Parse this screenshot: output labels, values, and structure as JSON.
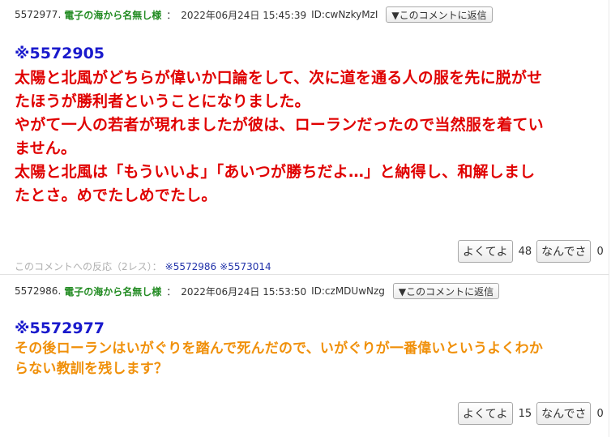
{
  "comments": [
    {
      "number": "5572977.",
      "name": "電子の海から名無し様",
      "separator": "：",
      "date": "2022年06月24日 15:45:39",
      "id": "ID:cwNzkyMzI",
      "reply_label": "▼このコメントに返信",
      "anchor": "※5572905",
      "body_lines": [
        "太陽と北風がどちらが偉いか口論をして、次に道を通る人の服を先に脱がせ",
        "たほうが勝利者ということになりました。",
        "やがて一人の若者が現れましたが彼は、ローランだったので当然服を着てい",
        "ません。",
        "太陽と北風は「もういいよ」「あいつが勝ちだよ…」と納得し、和解しまし",
        "たとさ。めでたしめでたし。"
      ],
      "good_label": "よくてよ",
      "good_count": "48",
      "bad_label": "なんでさ",
      "bad_count": "0",
      "reactions_label": "このコメントへの反応（2レス）：",
      "reactions": [
        "※5572986",
        "※5573014"
      ]
    },
    {
      "number": "5572986.",
      "name": "電子の海から名無し様",
      "separator": "：",
      "date": "2022年06月24日 15:53:50",
      "id": "ID:czMDUwNzg",
      "reply_label": "▼このコメントに返信",
      "anchor": "※5572977",
      "body_lines": [
        "その後ローランはいがぐりを踏んで死んだので、いがぐりが一番偉いというよくわか",
        "らない教訓を残します？"
      ],
      "good_label": "よくてよ",
      "good_count": "15",
      "bad_label": "なんでさ",
      "bad_count": "0"
    }
  ]
}
